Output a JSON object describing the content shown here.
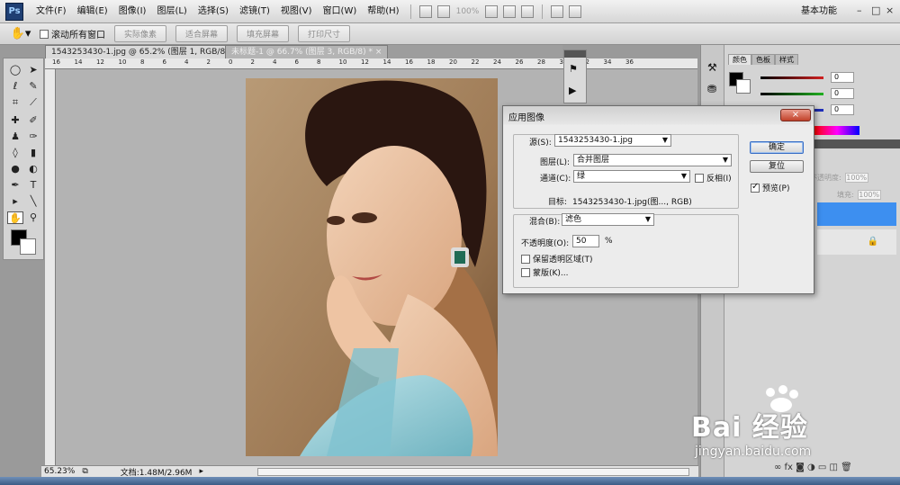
{
  "app": {
    "logo": "Ps",
    "menu": [
      "文件(F)",
      "编辑(E)",
      "图像(I)",
      "图层(L)",
      "选择(S)",
      "滤镜(T)",
      "视图(V)",
      "窗口(W)",
      "帮助(H)"
    ],
    "zoom_readout": "100%",
    "workspace": "基本功能",
    "win_controls": [
      "–",
      "□",
      "×"
    ]
  },
  "options": {
    "tool_icon": "hand-icon",
    "scroll_all": "滚动所有窗口",
    "buttons": [
      "实际像素",
      "适合屏幕",
      "填充屏幕",
      "打印尺寸"
    ]
  },
  "documents": {
    "tabs": [
      {
        "label": "1543253430-1.jpg @ 65.2% (图层 1, RGB/8#) *",
        "close": "×"
      },
      {
        "label": "未标题-1 @ 66.7% (图层 3, RGB/8) *",
        "close": "×"
      }
    ],
    "ruler_numbers": [
      "16",
      "14",
      "12",
      "10",
      "8",
      "6",
      "4",
      "2",
      "0",
      "2",
      "4",
      "6",
      "8",
      "10",
      "12",
      "14",
      "16",
      "18",
      "20",
      "22",
      "24",
      "26",
      "28",
      "30",
      "32",
      "34",
      "36"
    ]
  },
  "status": {
    "zoom": "65.23%",
    "doc_info": "文档:1.48M/2.96M"
  },
  "panels": {
    "tabs": [
      "颜色",
      "色板",
      "样式"
    ],
    "color_values": [
      "0",
      "0",
      "0"
    ],
    "layers_opacity_label": "不透明度:",
    "layers_opacity_value": "100%",
    "layers_fill_label": "填充:",
    "layers_fill_value": "100%",
    "colors": {
      "red": "#d02020",
      "green": "#20b020",
      "blue": "#2030c0",
      "layer_selected": "#3d8ff0"
    }
  },
  "dialog": {
    "title": "应用图像",
    "close": "×",
    "source_label": "源(S):",
    "source_value": "1543253430-1.jpg",
    "layer_label": "图层(L):",
    "layer_value": "合并图层",
    "channel_label": "通道(C):",
    "channel_value": "绿",
    "invert_label": "反相(I)",
    "target_label": "目标:",
    "target_value": "1543253430-1.jpg(图..., RGB)",
    "blending_label": "混合(B):",
    "blending_value": "滤色",
    "opacity_label": "不透明度(O):",
    "opacity_value": "50",
    "opacity_unit": "%",
    "preserve_label": "保留透明区域(T)",
    "mask_label": "蒙版(K)...",
    "ok_label": "确定",
    "reset_label": "复位",
    "preview_label": "预览(P)"
  },
  "watermark": {
    "brand": "Bai 经验",
    "url": "jingyan.baidu.com"
  }
}
